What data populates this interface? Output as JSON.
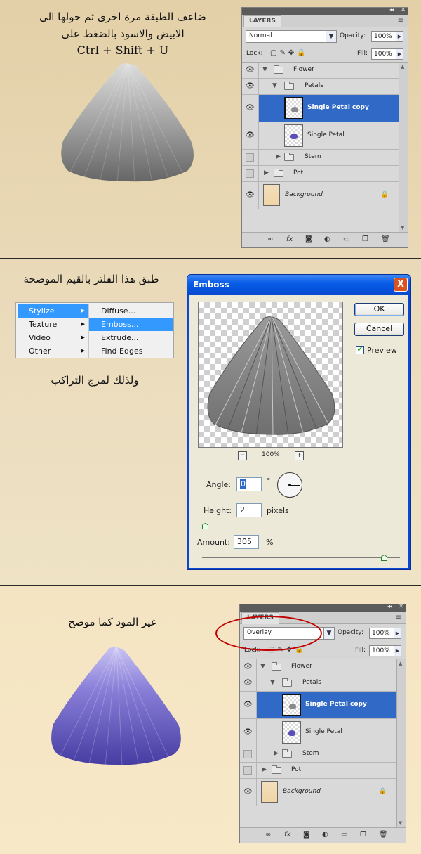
{
  "section1": {
    "arabic_line1": "ضاعف الطبقة مرة اخرى ثم حولها الى",
    "arabic_line2": "الابيض والاسود بالضغط على",
    "shortcut": "Ctrl + Shift + U"
  },
  "section2": {
    "arabic_title": "طبق هذا الفلتر بالقيم الموضحة",
    "arabic_note": "ولذلك لمزج التراكب"
  },
  "section3": {
    "arabic_title": "غير المود كما موضح"
  },
  "panel_top": {
    "tab": "LAYERS",
    "blend_mode": "Normal",
    "opacity_label": "Opacity:",
    "opacity": "100%",
    "lock_label": "Lock:",
    "fill_label": "Fill:",
    "fill": "100%"
  },
  "panel_bottom": {
    "tab": "LAYERS",
    "blend_mode": "Overlay",
    "opacity_label": "Opacity:",
    "opacity": "100%",
    "lock_label": "Lock:",
    "fill_label": "Fill:",
    "fill": "100%"
  },
  "layers": {
    "flower": "Flower",
    "petals": "Petals",
    "petal_copy": "Single Petal copy",
    "petal": "Single Petal",
    "stem": "Stem",
    "pot": "Pot",
    "background": "Background"
  },
  "stylize_menu": {
    "left": [
      "Stylize",
      "Texture",
      "Video",
      "Other"
    ],
    "right": [
      "Diffuse...",
      "Emboss...",
      "Extrude...",
      "Find Edges"
    ],
    "selected_left": "Stylize",
    "selected_right": "Emboss..."
  },
  "emboss": {
    "title": "Emboss",
    "close": "X",
    "ok": "OK",
    "cancel": "Cancel",
    "preview_label": "Preview",
    "zoom_minus": "−",
    "zoom": "100%",
    "zoom_plus": "+",
    "angle_label": "Angle:",
    "angle": "0",
    "angle_unit": "°",
    "height_label": "Height:",
    "height": "2",
    "height_unit": "pixels",
    "amount_label": "Amount:",
    "amount": "305",
    "amount_unit": "%",
    "height_slider_fraction": 0.0,
    "amount_slider_fraction": 0.92
  },
  "colors": {
    "selected_row": "#3169c6",
    "highlight": "#3399ff",
    "petal_purple": "#5a4fb8",
    "annotation": "#c20000"
  }
}
